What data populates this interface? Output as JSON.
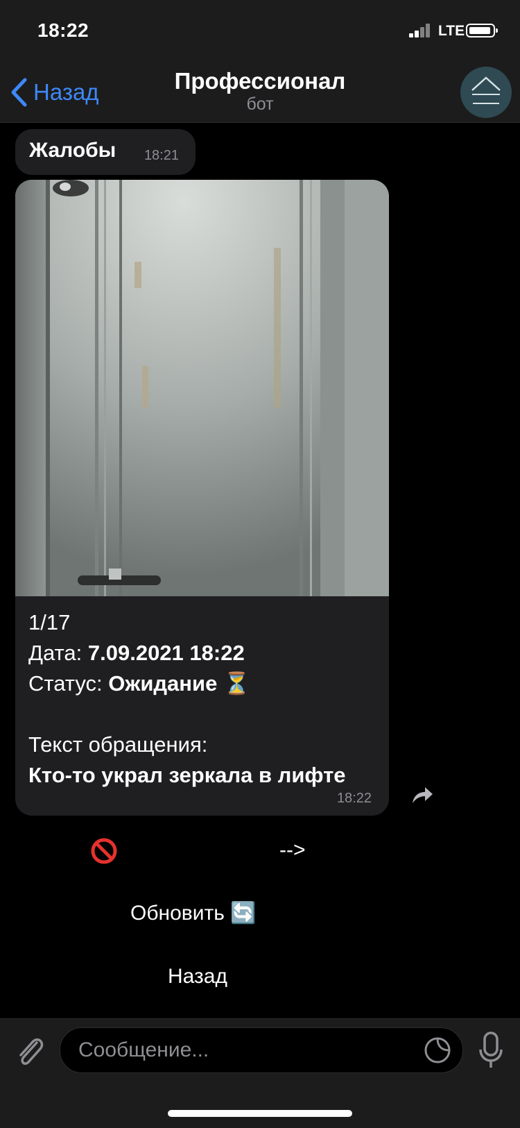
{
  "status_bar": {
    "time": "18:22",
    "network": "LTE"
  },
  "nav": {
    "back_label": "Назад",
    "title": "Профессионал",
    "subtitle": "бот"
  },
  "messages": [
    {
      "text": "Жалобы",
      "time": "18:21"
    },
    {
      "caption": {
        "counter": "1/17",
        "date_label": "Дата: ",
        "date_value": "7.09.2021  18:22",
        "status_label": "Статус: ",
        "status_value": "Ожидание",
        "status_emoji": "⏳",
        "text_label": "Текст обращения:",
        "text_value": "Кто-то украл зеркала в лифте"
      },
      "time": "18:22"
    }
  ],
  "keyboard": {
    "row1": {
      "cancel_icon": "no-entry-icon",
      "next_label": "-->"
    },
    "refresh_label": "Обновить",
    "refresh_emoji": "🔄",
    "back_label": "Назад"
  },
  "input": {
    "placeholder": "Сообщение..."
  },
  "colors": {
    "accent": "#3e88f7",
    "bubble": "#1f1f21",
    "bar": "#1c1c1d",
    "secondary_text": "#8e8e93"
  }
}
